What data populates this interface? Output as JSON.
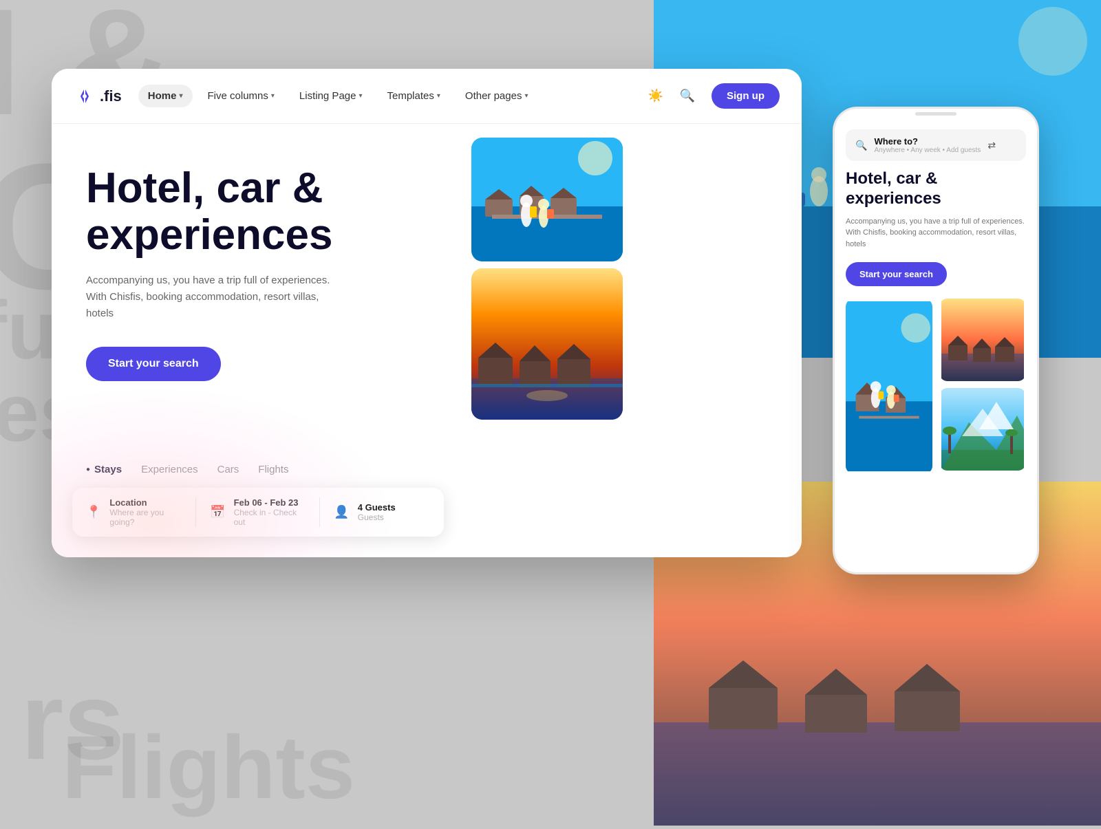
{
  "background": {
    "texts": [
      "I &",
      "C",
      "full c",
      "eso",
      "rs",
      "Flights"
    ]
  },
  "navbar": {
    "logo": {
      "text": ".fis"
    },
    "items": [
      {
        "label": "Home",
        "active": true
      },
      {
        "label": "Five columns",
        "active": false
      },
      {
        "label": "Listing Page",
        "active": false
      },
      {
        "label": "Templates",
        "active": false
      },
      {
        "label": "Other pages",
        "active": false
      }
    ],
    "signup_label": "Sign up"
  },
  "hero": {
    "title": "Hotel, car & experiences",
    "subtitle": "Accompanying us, you have a trip full of experiences. With Chisfis, booking accommodation, resort villas, hotels",
    "cta_label": "Start your search",
    "tabs": [
      {
        "label": "Stays",
        "active": true
      },
      {
        "label": "Experiences",
        "active": false
      },
      {
        "label": "Cars",
        "active": false
      },
      {
        "label": "Flights",
        "active": false
      }
    ],
    "search": {
      "location_label": "Location",
      "location_placeholder": "Where are you going?",
      "date_label": "Feb 06 - Feb 23",
      "date_sub": "Check in - Check out",
      "guests_label": "4 Guests",
      "guests_sub": "Guests"
    }
  },
  "phone": {
    "search_placeholder": "Where to?",
    "search_sub": "Anywhere • Any week • Add guests",
    "title": "Hotel, car & experiences",
    "subtitle": "Accompanying us, you have a trip full of experiences. With Chisfis, booking accommodation, resort villas, hotels",
    "cta_label": "Start your search"
  }
}
